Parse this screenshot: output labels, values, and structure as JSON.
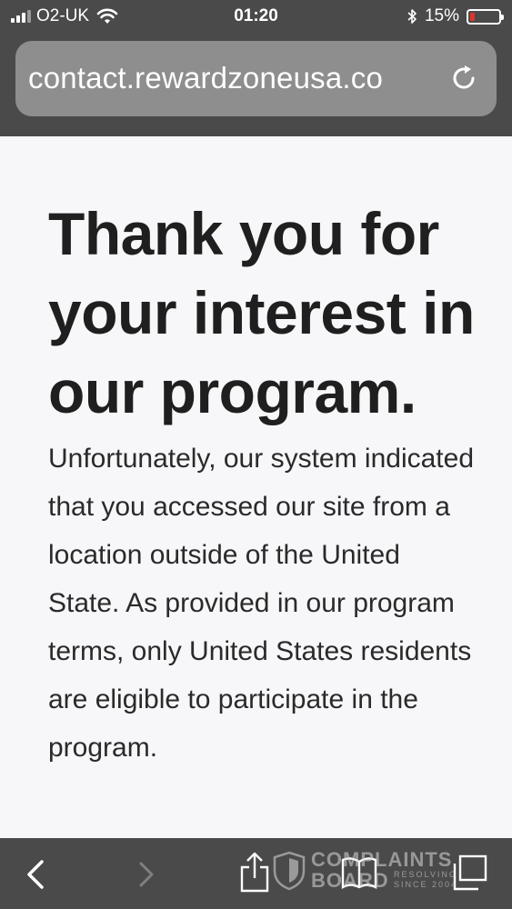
{
  "status_bar": {
    "carrier": "O2-UK",
    "time": "01:20",
    "battery_percent": "15%",
    "battery_level": 0.15,
    "battery_color": "#e0342c",
    "icons": [
      "signal-icon",
      "wifi-icon",
      "bluetooth-icon",
      "battery-icon"
    ]
  },
  "address_bar": {
    "url": "contact.rewardzoneusa.co",
    "reload_icon": "reload-icon"
  },
  "page": {
    "heading": "Thank you for your interest in our program.",
    "message": "Unfortunately, our system indicated that you accessed our site from a location outside of the United State. As provided in our program terms, only United States residents are eligible to participate in the program."
  },
  "toolbar": {
    "icons": [
      "back-icon",
      "forward-icon",
      "share-icon",
      "bookmarks-icon",
      "tabs-icon"
    ]
  },
  "watermark": {
    "title_line1": "COMPLAINTS",
    "title_line2": "BOARD",
    "tag_line1": "RESOLVING",
    "tag_line2": "SINCE 2004"
  },
  "colors": {
    "chrome": "#4a4a4a",
    "url_field": "#8e8e8e",
    "page_background": "#f7f7f9",
    "text": "#1f1f1f"
  }
}
